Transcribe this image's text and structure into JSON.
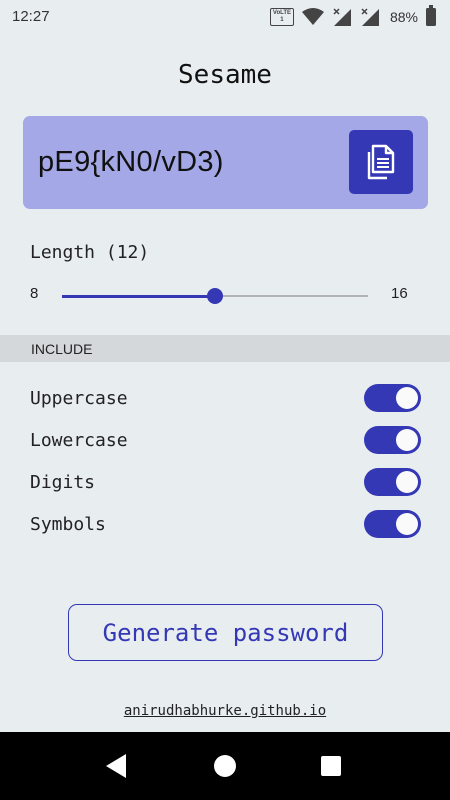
{
  "status_bar": {
    "time": "12:27",
    "volte_top": "VoLTE",
    "volte_bottom": "1",
    "battery_percent": "88%",
    "icons": [
      "volte-icon",
      "wifi-icon",
      "signal-icon",
      "signal-icon",
      "battery-icon"
    ]
  },
  "app": {
    "title": "Sesame"
  },
  "password": {
    "value": "pE9{kN0/vD3)",
    "copy_icon": "copy-icon"
  },
  "length": {
    "label": "Length (12)",
    "min": "8",
    "max": "16",
    "value": 12,
    "min_value": 8,
    "max_value": 16
  },
  "include": {
    "header": "INCLUDE",
    "options": [
      {
        "label": "Uppercase",
        "enabled": true
      },
      {
        "label": "Lowercase",
        "enabled": true
      },
      {
        "label": "Digits",
        "enabled": true
      },
      {
        "label": "Symbols",
        "enabled": true
      }
    ]
  },
  "generate_button": {
    "label": "Generate password"
  },
  "footer": {
    "link": "anirudhabhurke.github.io"
  },
  "colors": {
    "accent": "#3438b5",
    "card": "#a4a8e6",
    "background": "#e8edf0"
  }
}
